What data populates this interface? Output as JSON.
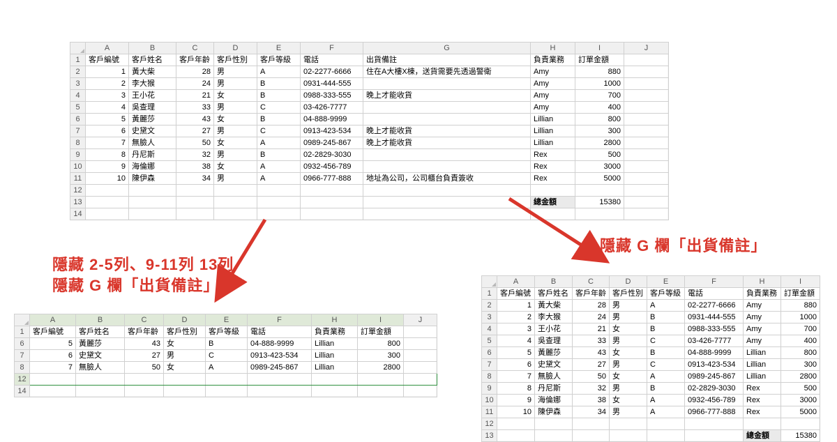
{
  "columns": {
    "A": "A",
    "B": "B",
    "C": "C",
    "D": "D",
    "E": "E",
    "F": "F",
    "G": "G",
    "H": "H",
    "I": "I",
    "J": "J"
  },
  "headers": {
    "id": "客戶編號",
    "name": "客戶姓名",
    "age": "客戶年齡",
    "gender": "客戶性別",
    "level": "客戶等級",
    "phone": "電話",
    "note": "出貨備註",
    "sales": "負責業務",
    "amount": "訂單金額"
  },
  "rows": [
    {
      "id": "1",
      "name": "黃大柴",
      "age": "28",
      "gender": "男",
      "level": "A",
      "phone": "02-2277-6666",
      "note": "住在A大樓X棟，送貨需要先透過警衛",
      "sales": "Amy",
      "amount": "880"
    },
    {
      "id": "2",
      "name": "李大猴",
      "age": "24",
      "gender": "男",
      "level": "B",
      "phone": "0931-444-555",
      "note": "",
      "sales": "Amy",
      "amount": "1000"
    },
    {
      "id": "3",
      "name": "王小花",
      "age": "21",
      "gender": "女",
      "level": "B",
      "phone": "0988-333-555",
      "note": "晚上才能收貨",
      "sales": "Amy",
      "amount": "700"
    },
    {
      "id": "4",
      "name": "吳查理",
      "age": "33",
      "gender": "男",
      "level": "C",
      "phone": "03-426-7777",
      "note": "",
      "sales": "Amy",
      "amount": "400"
    },
    {
      "id": "5",
      "name": "黃麗莎",
      "age": "43",
      "gender": "女",
      "level": "B",
      "phone": "04-888-9999",
      "note": "",
      "sales": "Lillian",
      "amount": "800"
    },
    {
      "id": "6",
      "name": "史黛文",
      "age": "27",
      "gender": "男",
      "level": "C",
      "phone": "0913-423-534",
      "note": "晚上才能收貨",
      "sales": "Lillian",
      "amount": "300"
    },
    {
      "id": "7",
      "name": "無臉人",
      "age": "50",
      "gender": "女",
      "level": "A",
      "phone": "0989-245-867",
      "note": "晚上才能收貨",
      "sales": "Lillian",
      "amount": "2800"
    },
    {
      "id": "8",
      "name": "丹尼斯",
      "age": "32",
      "gender": "男",
      "level": "B",
      "phone": "02-2829-3030",
      "note": "",
      "sales": "Rex",
      "amount": "500"
    },
    {
      "id": "9",
      "name": "海倫娜",
      "age": "38",
      "gender": "女",
      "level": "A",
      "phone": "0932-456-789",
      "note": "",
      "sales": "Rex",
      "amount": "3000"
    },
    {
      "id": "10",
      "name": "陳伊森",
      "age": "34",
      "gender": "男",
      "level": "A",
      "phone": "0966-777-888",
      "note": "地址為公司，公司櫃台負責簽收",
      "sales": "Rex",
      "amount": "5000"
    }
  ],
  "total": {
    "label": "總金額",
    "value": "15380"
  },
  "sheet2": {
    "visible_rows": [
      5,
      6,
      7
    ],
    "row_labels": [
      "6",
      "7",
      "8",
      "12",
      "14"
    ]
  },
  "sheet3": {
    "headers_noG": true
  },
  "anno_left_line1": "隱藏 2-5列、9-11列 13列",
  "anno_left_line2": "隱藏 G 欄「出貨備註」",
  "anno_right": "隱藏 G 欄「出貨備註」"
}
